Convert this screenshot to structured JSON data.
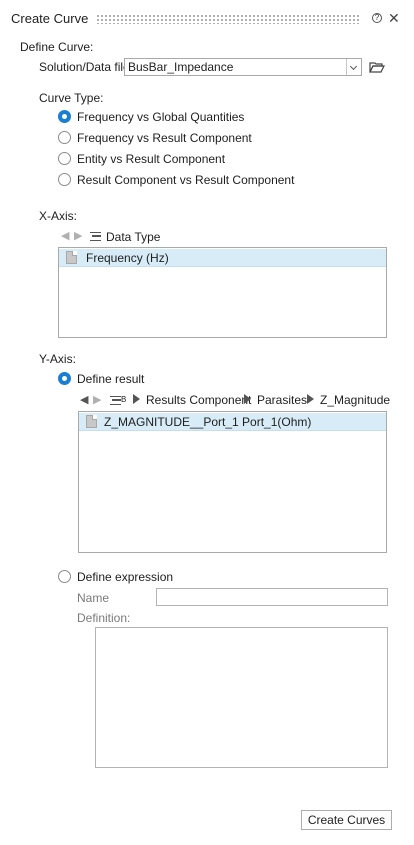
{
  "window": {
    "title": "Create Curve"
  },
  "define_curve": {
    "heading": "Define Curve:",
    "source_label": "Solution/Data file",
    "source_value": "BusBar_Impedance"
  },
  "curve_type": {
    "heading": "Curve Type:",
    "options": [
      {
        "label": "Frequency vs Global Quantities",
        "selected": true
      },
      {
        "label": "Frequency vs Result Component",
        "selected": false
      },
      {
        "label": "Entity vs Result Component",
        "selected": false
      },
      {
        "label": "Result Component vs Result Component",
        "selected": false
      }
    ]
  },
  "x_axis": {
    "heading": "X-Axis:",
    "breadcrumb": "Data Type",
    "items": [
      "Frequency (Hz)"
    ]
  },
  "y_axis": {
    "heading": "Y-Axis:",
    "define_result_label": "Define result",
    "breadcrumb": [
      "Results Component",
      "Parasites",
      "Z_Magnitude"
    ],
    "items": [
      "Z_MAGNITUDE__Port_1 Port_1(Ohm)"
    ],
    "define_expression_label": "Define expression",
    "name_label": "Name",
    "name_value": "",
    "definition_label": "Definition:",
    "definition_value": ""
  },
  "actions": {
    "create_label": "Create Curves"
  },
  "colors": {
    "accent": "#1a7fd4",
    "selection": "#d7ecf7"
  },
  "icons": [
    "help-icon",
    "close-icon",
    "folder-open-icon",
    "back-arrow-icon",
    "forward-arrow-icon",
    "tree-icon",
    "document-icon"
  ]
}
